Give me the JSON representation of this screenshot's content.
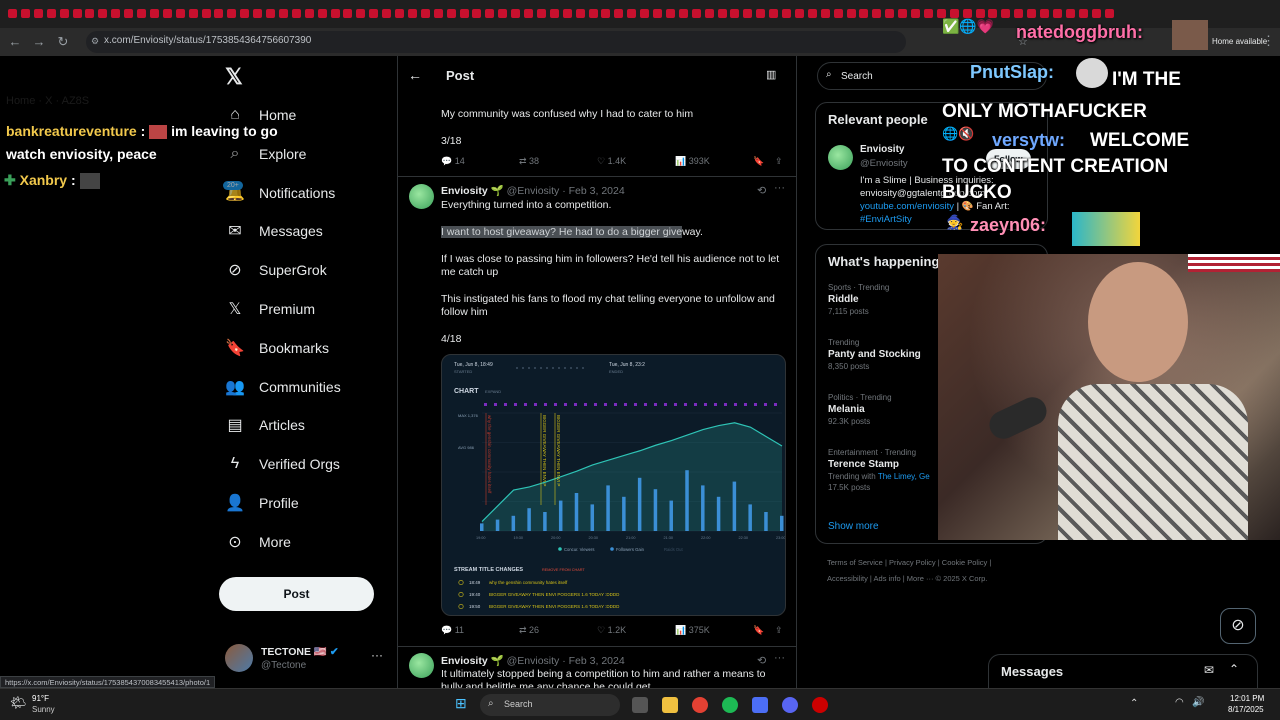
{
  "browser": {
    "url": "x.com/Enviosity/status/1753854364756607390",
    "status_link": "https://x.com/Enviosity/status/1753854370083455413/photo/1",
    "home_available": "Home available"
  },
  "sidebar": {
    "items": [
      {
        "label": "Home",
        "icon": "home-icon"
      },
      {
        "label": "Explore",
        "icon": "search-icon"
      },
      {
        "label": "Notifications",
        "icon": "bell-icon"
      },
      {
        "label": "Messages",
        "icon": "envelope-icon"
      },
      {
        "label": "SuperGrok",
        "icon": "grok-icon"
      },
      {
        "label": "Premium",
        "icon": "x-icon"
      },
      {
        "label": "Bookmarks",
        "icon": "bookmark-icon"
      },
      {
        "label": "Communities",
        "icon": "people-icon"
      },
      {
        "label": "Articles",
        "icon": "article-icon"
      },
      {
        "label": "Verified Orgs",
        "icon": "lightning-icon"
      },
      {
        "label": "Profile",
        "icon": "person-icon"
      },
      {
        "label": "More",
        "icon": "more-circle-icon"
      }
    ],
    "notif_badge": "20+",
    "post_label": "Post",
    "account": {
      "name": "TECTONE 🇺🇸",
      "handle": "@Tectone"
    }
  },
  "main": {
    "header": "Post",
    "prev_tweet": {
      "text": "My community was confused why I had to cater to him",
      "counter": "3/18",
      "actions": {
        "replies": "14",
        "retweets": "38",
        "likes": "1.4K",
        "views": "393K"
      }
    },
    "tweet": {
      "name": "Enviosity",
      "handle": "@Enviosity",
      "date": "· Feb 3, 2024",
      "p1": "Everything turned into a competition.",
      "p2_highlight": "I want to host giveaway? He had to do a bigger give",
      "p2_rest": "way.",
      "p3": "If I was close to passing him in followers? He'd tell his audience not to let me catch up",
      "p4": "This instigated his fans to flood my chat telling everyone to unfollow and follow him",
      "counter": "4/18",
      "actions": {
        "replies": "11",
        "retweets": "26",
        "likes": "1.2K",
        "views": "375K"
      }
    },
    "next_tweet": {
      "name": "Enviosity",
      "handle": "@Enviosity",
      "date": "· Feb 3, 2024",
      "text": "It ultimately stopped being a competition to him and rather a means to bully and belittle me any chance he could get"
    }
  },
  "chart_data": {
    "type": "line",
    "title": "CHART",
    "subtitle": "EXPAND",
    "start_label": "Tue, Jun 8, 18:49",
    "start_sub": "STARTED",
    "end_label": "Tue, Jun 8, 23:2",
    "end_sub": "ENDED",
    "y_labels": [
      "MAX 1,376",
      "AVG 986"
    ],
    "x": [
      "19:00",
      "19:30",
      "20:00",
      "20:30",
      "21:00",
      "21:30",
      "22:00",
      "22:30",
      "23:00"
    ],
    "series": [
      {
        "name": "Concur. Viewers",
        "values": [
          120,
          320,
          520,
          560,
          620,
          690,
          760,
          840,
          900,
          960,
          1020,
          1090,
          1150,
          1220,
          1290,
          1340,
          1376,
          1320,
          1200,
          1080
        ]
      },
      {
        "name": "Followers Gain",
        "values": [
          2,
          3,
          4,
          6,
          5,
          8,
          10,
          7,
          12,
          9,
          14,
          11,
          8,
          16,
          12,
          9,
          13,
          7,
          5,
          4
        ]
      }
    ],
    "legend_extra": "Raids Out",
    "annotations": [
      "why the genshin community hates itself",
      "BIGGER GIVEAWAY THEN ENVI P",
      "BIGGER GIVEAWAY THEN ENVI P"
    ],
    "stream_title_header": "STREAM TITLE CHANGES",
    "remove_label": "REMOVE FROM CHART",
    "stream_title_changes": [
      {
        "time": "18:49",
        "title": "why the genshin community hates itself"
      },
      {
        "time": "19:40",
        "title": "BIGGER GIVEAWAY THEN ENVI POGGERS 1.6 TODAY :DDDD"
      },
      {
        "time": "19:50",
        "title": "BIGGER GIVEAWAY THEN ENVI POGGERS 1.6 TODAY :DDDD"
      }
    ]
  },
  "right": {
    "search_placeholder": "Search",
    "relevant_title": "Relevant people",
    "person": {
      "name": "Enviosity",
      "handle": "@Enviosity",
      "follow": "Follow",
      "bio1": "I'm a Slime | Business inquiries:",
      "bio2": "enviosity@ggtalentgroup.com",
      "link": "youtube.com/enviosity",
      "fanart": "Fan Art:",
      "tag": "#EnviArtSity"
    },
    "whats_happening": "What's happening",
    "trends": [
      {
        "cat": "Sports · Trending",
        "name": "Riddle",
        "count": "7,115 posts"
      },
      {
        "cat": "Trending",
        "name": "Panty and Stocking",
        "count": "8,350 posts"
      },
      {
        "cat": "Politics · Trending",
        "name": "Melania",
        "count": "92.3K posts"
      },
      {
        "cat": "Entertainment · Trending",
        "name": "Terence Stamp",
        "count": "17.5K posts",
        "with": "Trending with",
        "with_link": "The Limey, Ge"
      }
    ],
    "show_more": "Show more",
    "footer1": [
      "Terms of Service",
      "Privacy Policy",
      "Cookie Policy"
    ],
    "footer2": [
      "Accessibility",
      "Ads info",
      "More ···",
      "© 2025 X Corp."
    ],
    "messages": "Messages"
  },
  "overlay": {
    "chat1_user": "bankreatureventure",
    "chat1_text": "im leaving to go watch enviosity, peace",
    "chat2_user": "Xanbry",
    "right_user1": "natedoggbruh:",
    "right_user2": "PnutSlap:",
    "right_msg2": "I'M THE ONLY MOTHAFUCKER",
    "right_user3": "versytw:",
    "right_msg3": "WELCOME TO CONTENT CREATION BUCKO",
    "right_user4": "zaeyn06:",
    "faded_title": "Home · X · AZ8S"
  },
  "taskbar": {
    "temp": "91°F",
    "weather": "Sunny",
    "search": "Search",
    "time": "12:01 PM",
    "date": "8/17/2025"
  },
  "colors": {
    "accent": "#1d9bf0",
    "green": "#3aa05a",
    "bg": "#000000",
    "divider": "#2f3336"
  }
}
